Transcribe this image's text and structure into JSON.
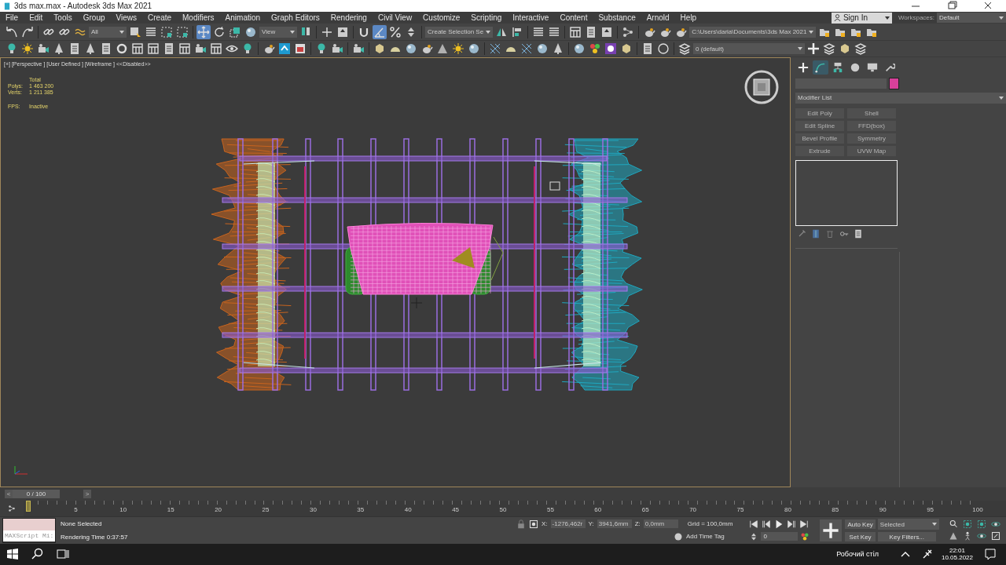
{
  "window": {
    "title": "3ds max.max - Autodesk 3ds Max 2021"
  },
  "menu": [
    "File",
    "Edit",
    "Tools",
    "Group",
    "Views",
    "Create",
    "Modifiers",
    "Animation",
    "Graph Editors",
    "Rendering",
    "Civil View",
    "Customize",
    "Scripting",
    "Interactive",
    "Content",
    "Substance",
    "Arnold",
    "Help"
  ],
  "account": {
    "sign_in": "Sign In",
    "workspaces_label": "Workspaces:",
    "workspace": "Default"
  },
  "main_toolbar": {
    "selection_filter": "All",
    "reference_coord": "View",
    "named_selection": "Create Selection Se",
    "project_path": "C:\\Users\\daria\\Documents\\3ds Max 2021",
    "buttons": [
      {
        "selected": false
      },
      {
        "selected": false
      },
      {
        "selected": false
      },
      {
        "selected": false
      },
      {
        "selected": false
      },
      {
        "selected": false
      },
      {
        "selected": false
      },
      {
        "selected": false
      },
      {
        "selected": false
      },
      {
        "selected": true
      },
      {
        "selected": false
      },
      {
        "selected": false
      },
      {
        "selected": false
      },
      {
        "selected": false
      },
      {
        "selected": false
      },
      {
        "selected": false
      },
      {
        "selected": false
      },
      {
        "selected": true
      },
      {
        "selected": false
      },
      {
        "selected": false
      },
      {
        "selected": false
      },
      {
        "selected": false
      },
      {
        "selected": false
      },
      {
        "selected": false
      },
      {
        "selected": false
      },
      {
        "selected": false
      },
      {
        "selected": false
      },
      {
        "selected": false
      },
      {
        "selected": false
      },
      {
        "selected": false
      },
      {
        "selected": false
      },
      {
        "selected": false
      },
      {
        "selected": false
      },
      {
        "selected": false
      },
      {
        "selected": false
      }
    ]
  },
  "second_toolbar": {
    "layer": "0 (default)"
  },
  "viewport": {
    "label": "[+] [Perspective ] [User Defined ] [Wireframe ] <<Disabled>>",
    "stats_header": "Total",
    "stats": [
      {
        "label": "Polys:",
        "value": "1 463 200"
      },
      {
        "label": "Verts:",
        "value": "1 211 385"
      }
    ],
    "fps": {
      "label": "FPS:",
      "value": "Inactive"
    }
  },
  "command_panel": {
    "tabs": [
      {
        "selected": false
      },
      {
        "selected": true
      },
      {
        "selected": false
      },
      {
        "selected": false
      },
      {
        "selected": false
      },
      {
        "selected": false
      }
    ],
    "swatch": {
      "color": "#d8409a"
    },
    "modifier_list": "Modifier List",
    "modifier_buttons": [
      {
        "label": "Edit Poly",
        "disabled": true
      },
      {
        "label": "Shell",
        "disabled": true
      },
      {
        "label": "Edit Spline",
        "disabled": true
      },
      {
        "label": "FFD(box)",
        "disabled": true
      },
      {
        "label": "Bevel Profile",
        "disabled": true
      },
      {
        "label": "Symmetry",
        "disabled": true
      },
      {
        "label": "Extrude",
        "disabled": true
      },
      {
        "label": "UVW Map",
        "disabled": true
      }
    ]
  },
  "time_slider": {
    "label": "0 / 100",
    "prev": "<",
    "next": ">",
    "level": 0
  },
  "timeline": {
    "ticks": [
      "5",
      "10",
      "15",
      "20",
      "25",
      "30",
      "35",
      "40",
      "45",
      "50",
      "55",
      "60",
      "65",
      "70",
      "75",
      "80",
      "85",
      "90",
      "95",
      "100"
    ]
  },
  "status": {
    "maxscript": "MAXScript Mi:",
    "selection": "None Selected",
    "render_time": "Rendering Time  0:37:57",
    "x_label": "X:",
    "x": "-1276,462r",
    "y_label": "Y:",
    "y": "3941,6mm",
    "z_label": "Z:",
    "z": "0,0mm",
    "grid": "Grid = 100,0mm",
    "time_tag": "Add Time Tag",
    "frame": "0",
    "auto_key": "Auto Key",
    "set_key": "Set Key",
    "key_set": "Selected",
    "key_filters": "Key Filters..."
  },
  "taskbar": {
    "desktop": "Робочий стіл",
    "time": "22:01",
    "date": "10.05.2022"
  }
}
